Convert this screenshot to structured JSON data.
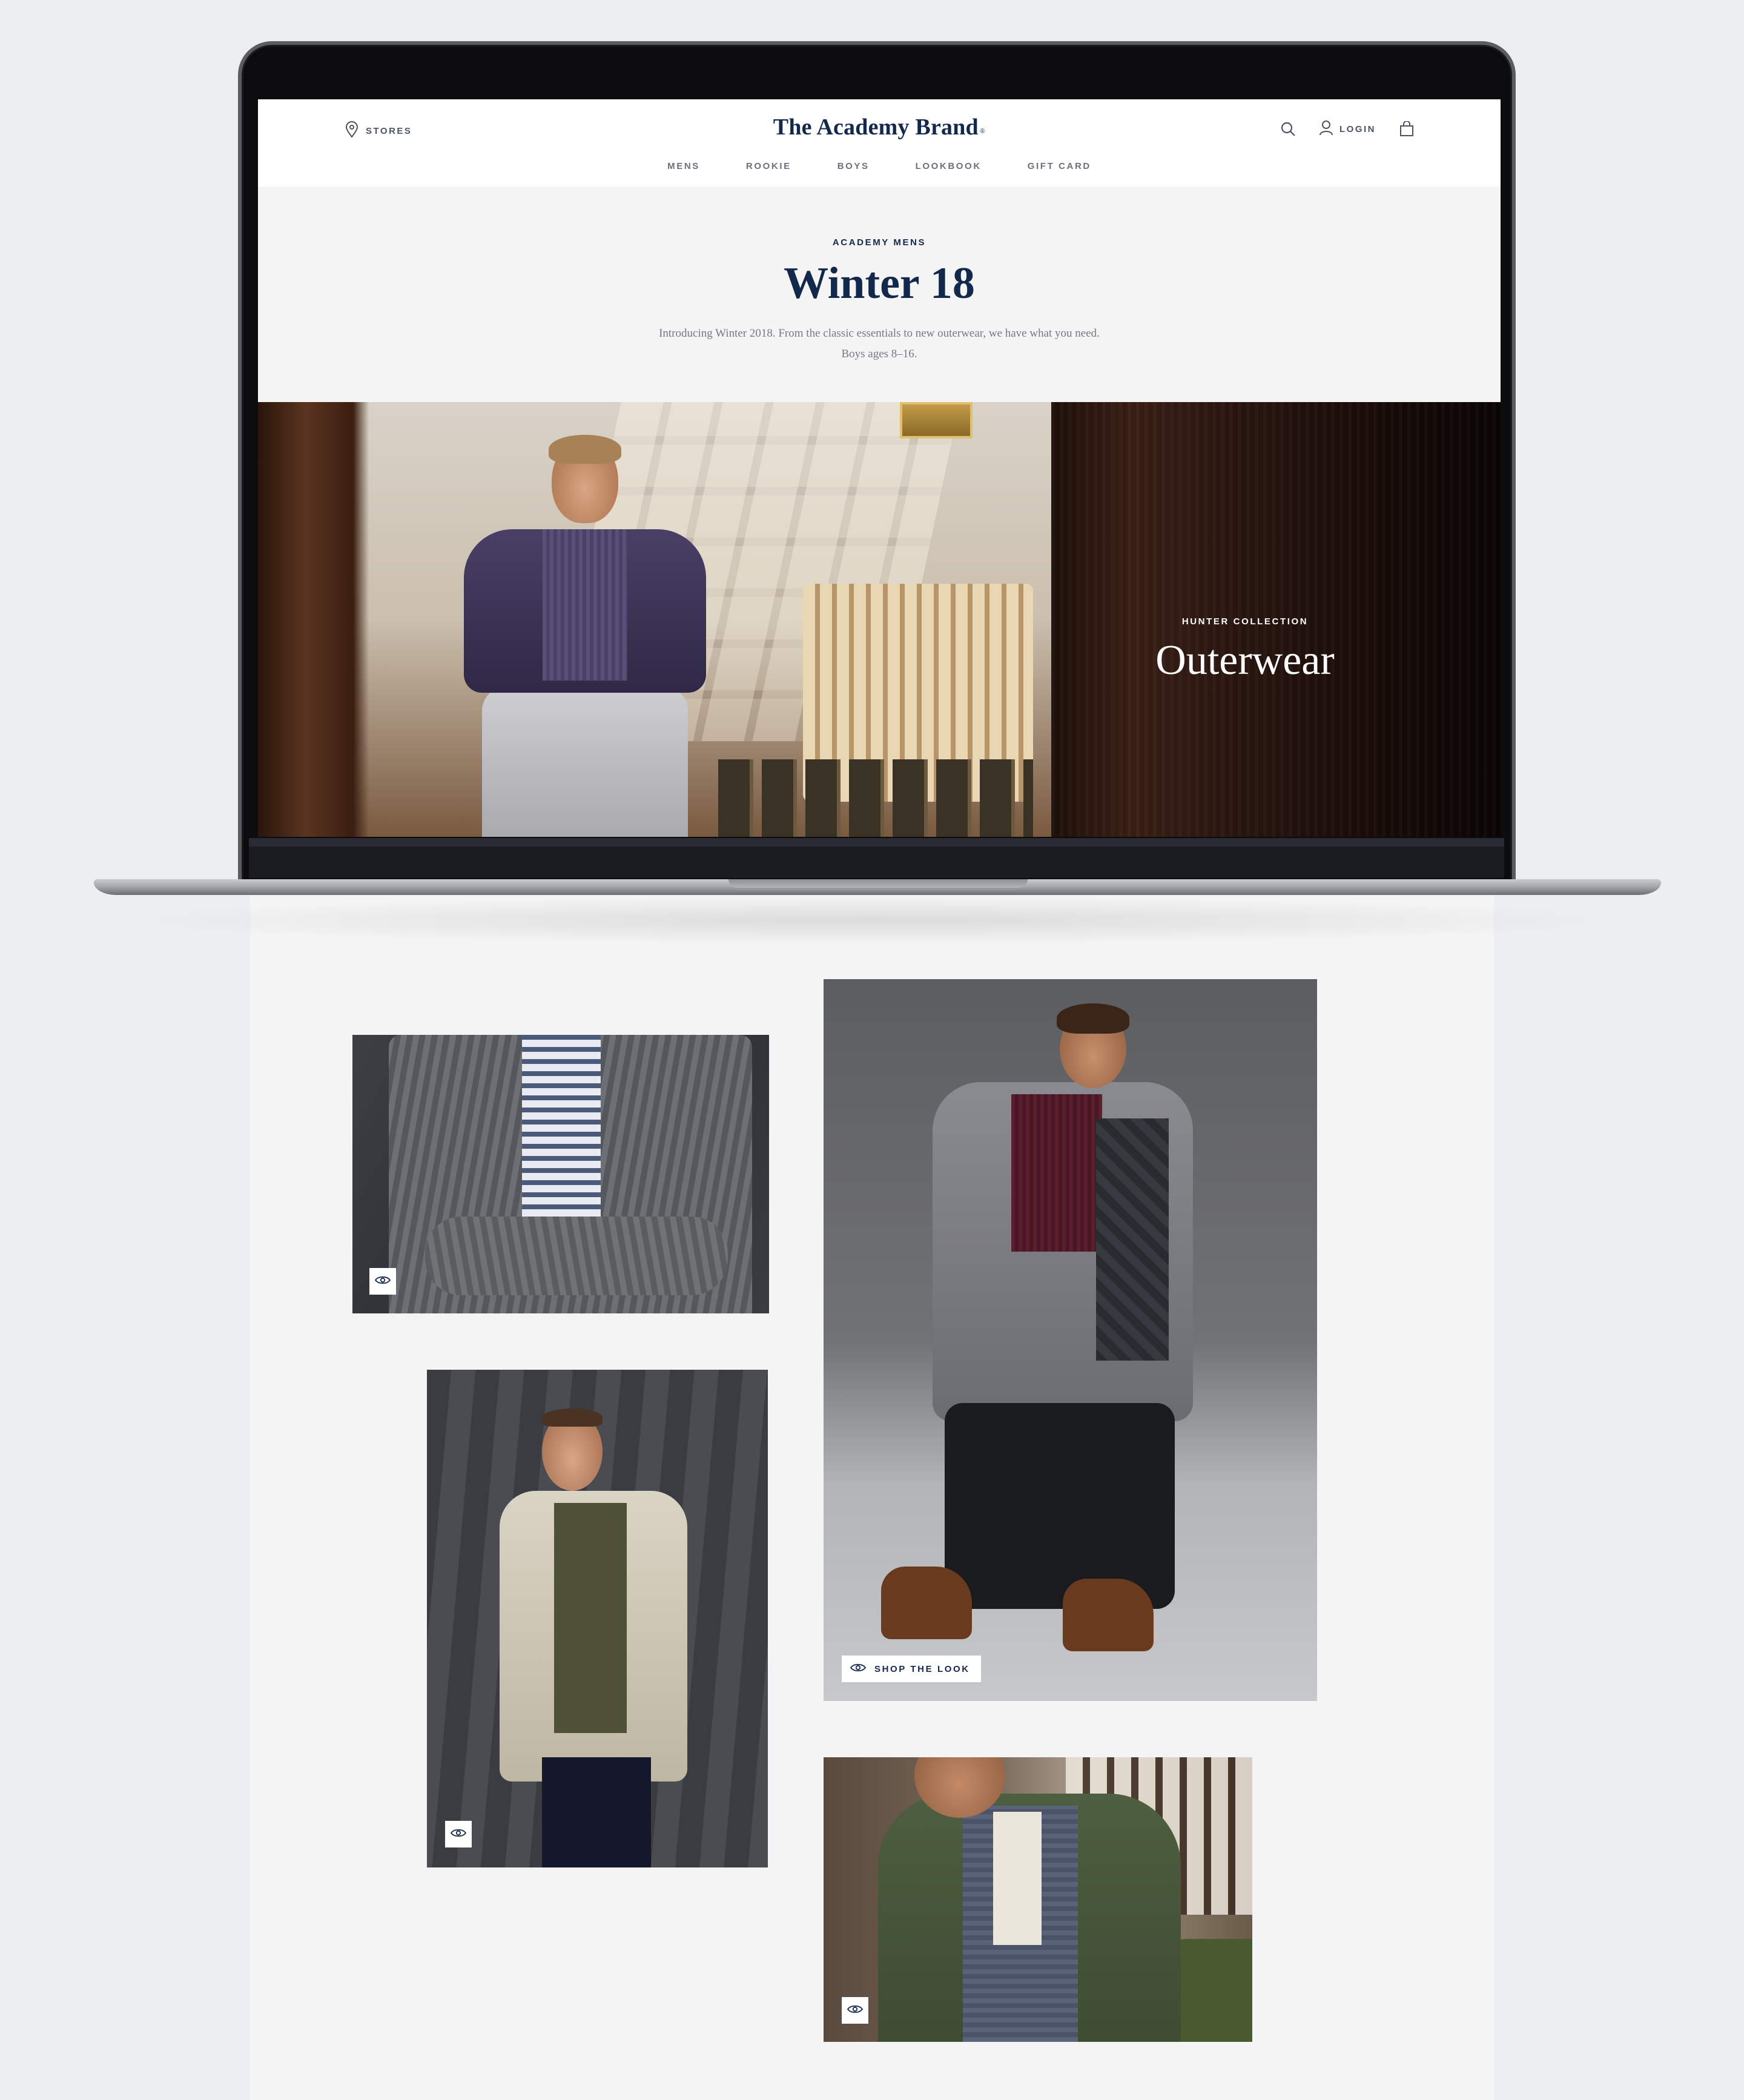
{
  "header": {
    "stores_label": "STORES",
    "brand": "The Academy Brand",
    "brand_mark": "®",
    "login_label": "LOGIN",
    "nav": [
      "MENS",
      "ROOKIE",
      "BOYS",
      "LOOKBOOK",
      "GIFT CARD"
    ]
  },
  "intro": {
    "eyebrow": "ACADEMY MENS",
    "title": "Winter 18",
    "description_line1": "Introducing Winter 2018. From the classic essentials to new outerwear, we have what you need.",
    "description_line2": "Boys ages 8–16."
  },
  "hero": {
    "eyebrow": "HUNTER COLLECTION",
    "title": "Outerwear"
  },
  "lookbook": {
    "shop_the_look_label": "SHOP THE LOOK"
  },
  "icons": {
    "stores": "location-pin-icon",
    "search": "search-icon",
    "user": "user-icon",
    "bag": "shopping-bag-icon",
    "quick_view": "eye-icon"
  },
  "colors": {
    "brand_navy": "#13294b",
    "nav_gray": "#6a707c",
    "intro_background": "#f4f4f5"
  }
}
